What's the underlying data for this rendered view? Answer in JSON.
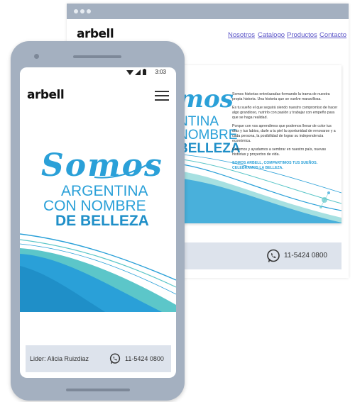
{
  "desktop": {
    "logo": "arbell",
    "nav": [
      "Nosotros",
      "Catalogo",
      "Productos",
      "Contacto"
    ],
    "paragraphs": [
      "Somos historias entrelazadas formando la trama de nuestra propia historia. Una historia que se vuelve maravillosa.",
      "Es tu sueño el que seguirá siendo nuestro compromiso de hacer algo grandioso, nutrirlo con pasión y trabajar con empeño para que se haga realidad.",
      "Porque con vos aprendimos que podemos llenar de color tus días y tus labios, darle a tu piel la oportunidad de renovarse y a cada persona, la posibilidad de lograr su independencia económica.",
      "Creemos y ayudamos a sembrar en nuestro país, nuevas historias y proyectos de vida."
    ],
    "highlight": "SOMOS ARBELL, COMPARTIMOS TUS SUEÑOS. CELEBRAMOS LA BELLEZA.",
    "hero_partial": "mos",
    "hero_lines": [
      "NTINA",
      "NOMBRE",
      "BELLEZA"
    ],
    "phone": "11-5424 0800"
  },
  "mobile": {
    "status_time": "3:03",
    "logo": "arbell",
    "hero_script": "Somos",
    "hero_lines": [
      "ARGENTINA",
      "CON NOMBRE",
      "DE BELLEZA"
    ],
    "footer_leader": "Lider: Alicia Ruizdiaz",
    "phone": "11-5424 0800"
  },
  "colors": {
    "brand_blue": "#2aa0d8",
    "deep_blue": "#1f8fc8",
    "teal": "#5cc6c9",
    "frame_gray": "#a4b0c0",
    "footer_gray": "#dde3ec",
    "nav_link": "#5b55c8"
  },
  "icons": [
    "whatsapp-icon",
    "hamburger-menu-icon",
    "wifi-icon",
    "signal-icon",
    "battery-icon"
  ]
}
